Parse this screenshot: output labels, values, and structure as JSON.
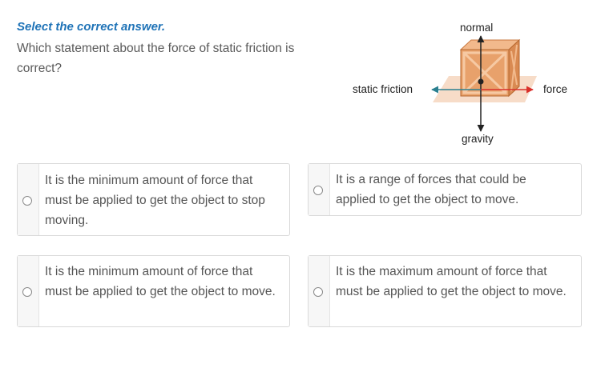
{
  "instruction": "Select the correct answer.",
  "question": "Which statement about the force of static friction is correct?",
  "figure": {
    "labels": {
      "normal": "normal",
      "gravity": "gravity",
      "static_friction": "static friction",
      "force": "force"
    },
    "colors": {
      "friction_arrow": "#2a7f8f",
      "force_arrow": "#d9302a",
      "vertical_arrows": "#222222",
      "crate": "#e8a16b",
      "floor": "#f7dcc8"
    }
  },
  "options": [
    {
      "text": "It is the minimum amount of force that must be applied to get the object to stop moving.",
      "selected": false
    },
    {
      "text": "It is a range of forces that could be applied to get the object to move.",
      "selected": false
    },
    {
      "text": "It is the minimum amount of force that must be applied to get the object to move.",
      "selected": false
    },
    {
      "text": "It is the maximum amount of force that must be applied to get the object to move.",
      "selected": false
    }
  ]
}
